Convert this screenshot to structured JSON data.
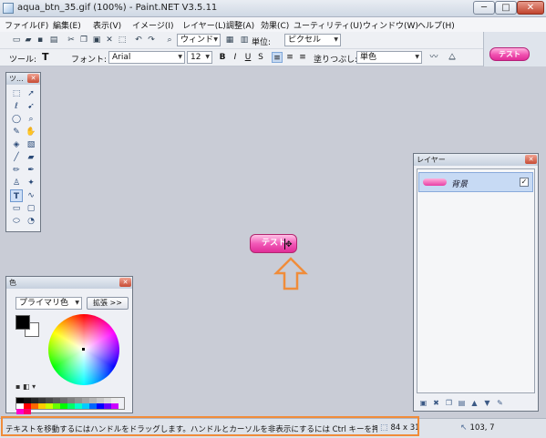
{
  "window": {
    "title": "aqua_btn_35.gif (100%) - Paint.NET V3.5.11",
    "minimize": "─",
    "maximize": "□",
    "close": "✕"
  },
  "menu": [
    "ファイル(F)",
    "編集(E)",
    "表示(V)",
    "イメージ(I)",
    "レイヤー(L)",
    "調整(A)",
    "効果(C)",
    "ユーティリティ(U)",
    "ウィンドウ(W)",
    "ヘルプ(H)"
  ],
  "toolbar1": {
    "zoom_combo": "ウィンド",
    "units_label": "単位:",
    "units_combo": "ピクセル"
  },
  "toolbar2": {
    "tool_label": "ツール:",
    "tool_glyph": "T",
    "font_label": "フォント:",
    "font_combo": "Arial",
    "size_combo": "12",
    "fill_label": "塗りつぶし:",
    "fill_combo": "単色",
    "bold": "B",
    "italic": "I",
    "underline": "U"
  },
  "thumbnail": {
    "label": "テスト"
  },
  "tools_palette": {
    "title": "ツ..."
  },
  "layers_palette": {
    "title": "レイヤー",
    "layer_name": "背景",
    "layer_visible": "✓"
  },
  "colors_palette": {
    "title": "色",
    "mode": "プライマリ色",
    "expand": "拡張 >>",
    "primary": "#000000",
    "secondary": "#ffffff"
  },
  "canvas": {
    "button_text": "テスト",
    "handle": "✥"
  },
  "status": {
    "text": "テキストを移動するにはハンドルをドラッグします。ハンドルとカーソルを非表示にするには Ctrl キーを押下します。ハンドル",
    "size": "84 x 31",
    "position": "103, 7"
  },
  "colors": {
    "highlight": "#f08c3a",
    "accent_pink": "#e83ea4"
  }
}
